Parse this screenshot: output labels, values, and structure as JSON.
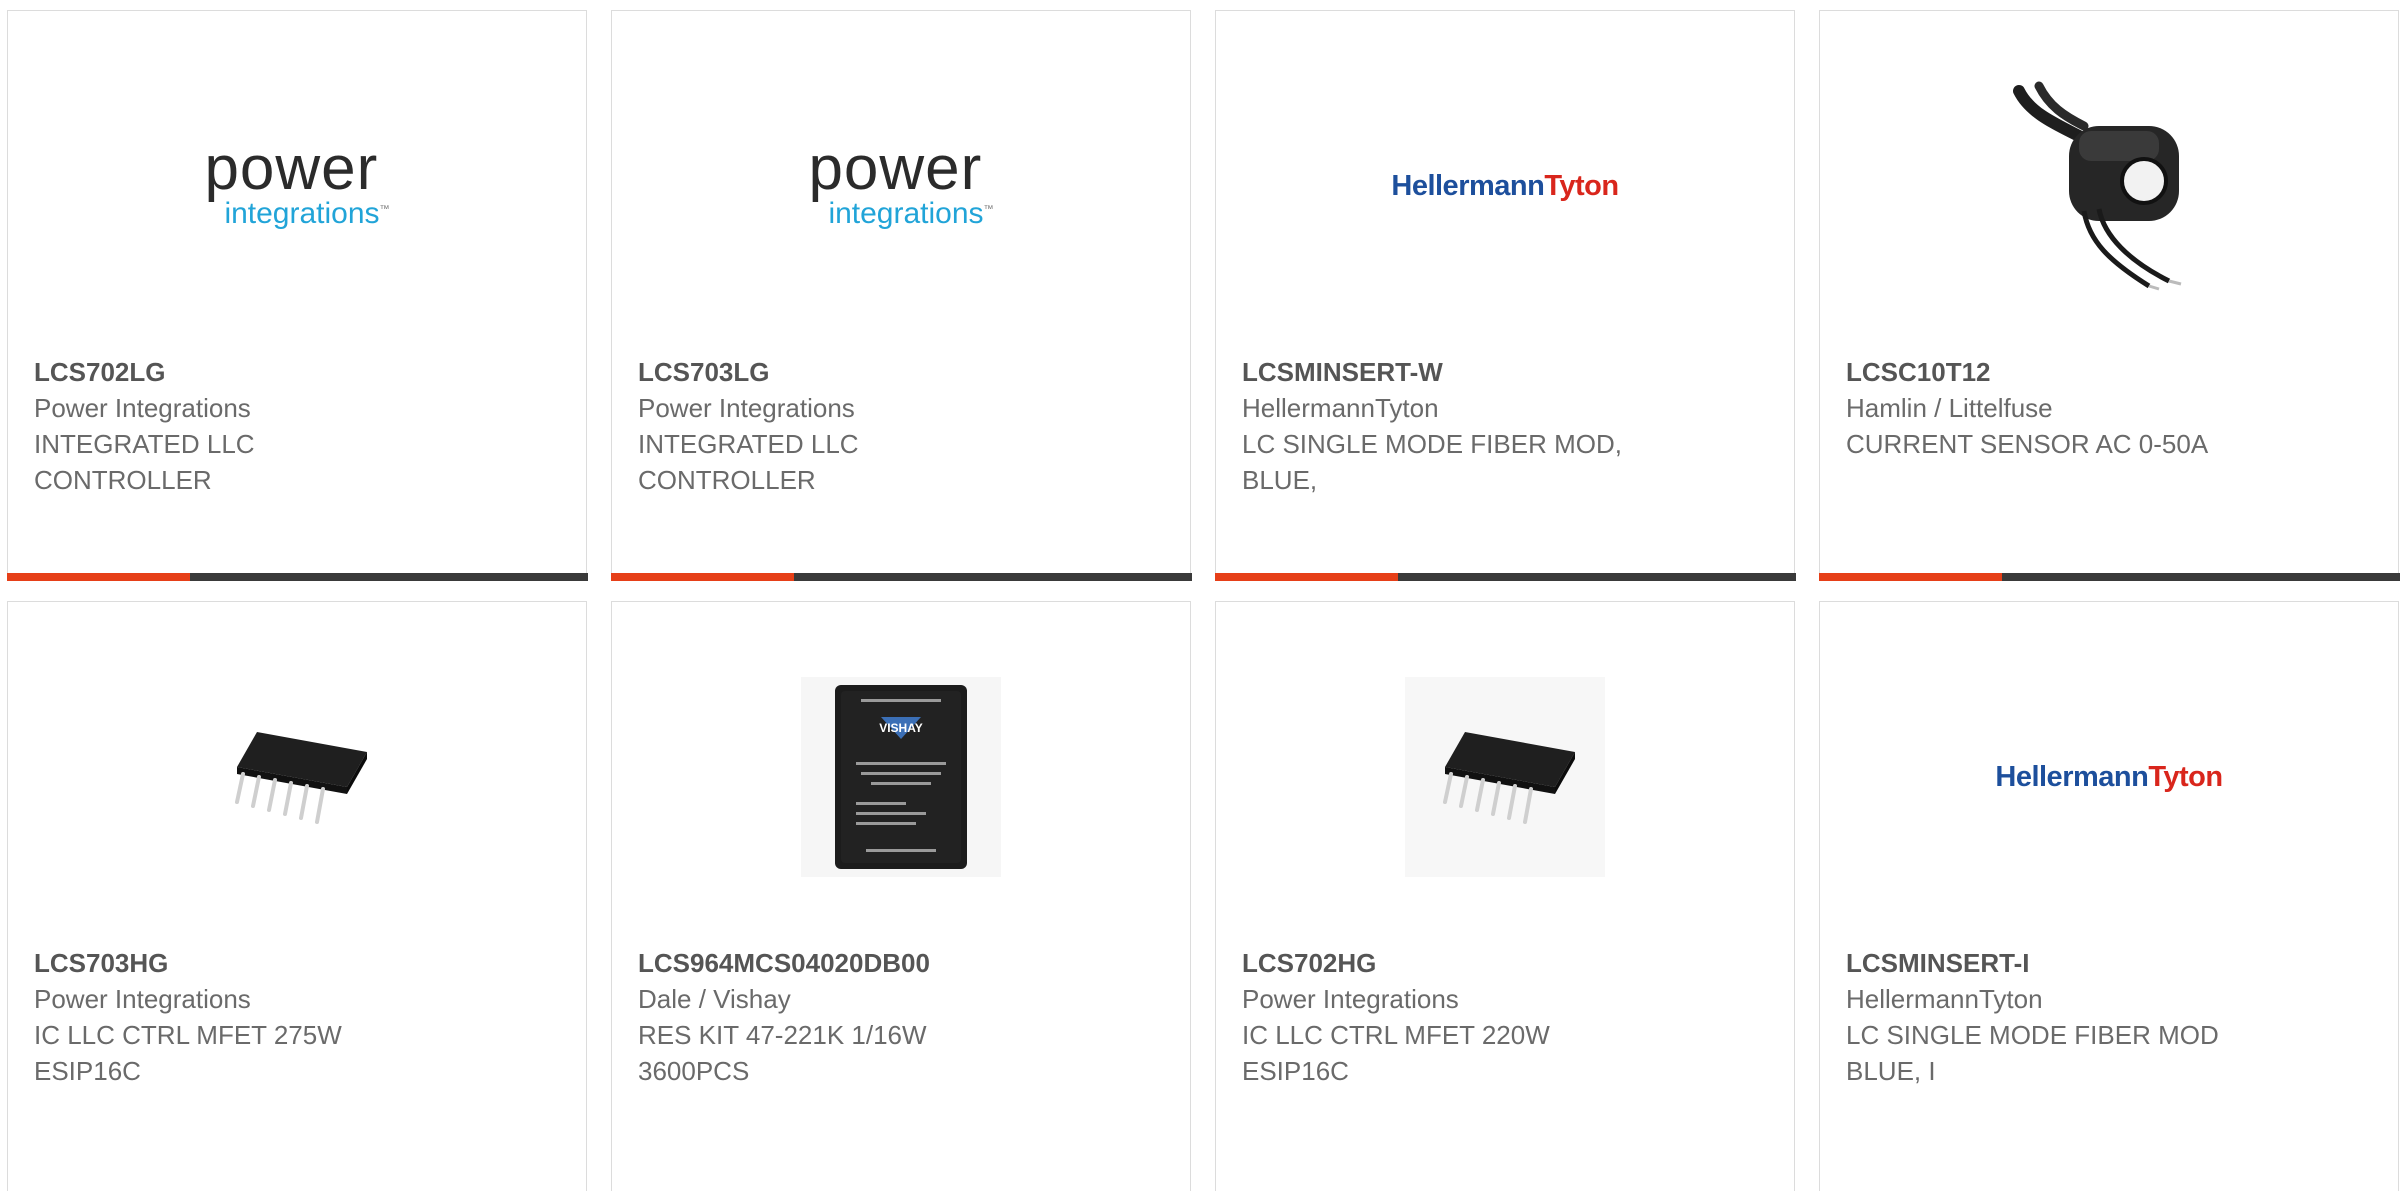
{
  "cards": [
    {
      "part_number": "LCS702LG",
      "manufacturer": "Power Integrations",
      "description": "INTEGRATED LLC\nCONTROLLER",
      "image": "power-integrations-logo",
      "logo_text": {
        "line1": "power",
        "line2": "integrations",
        "tm": "™"
      }
    },
    {
      "part_number": "LCS703LG",
      "manufacturer": "Power Integrations",
      "description": "INTEGRATED LLC\nCONTROLLER",
      "image": "power-integrations-logo",
      "logo_text": {
        "line1": "power",
        "line2": "integrations",
        "tm": "™"
      }
    },
    {
      "part_number": "LCSMINSERT-W",
      "manufacturer": "HellermannTyton",
      "description": "LC SINGLE MODE FIBER MOD,\nBLUE,",
      "image": "hellermanntyton-logo",
      "logo_text": {
        "part1": "Hellermann",
        "part2": "Tyton"
      }
    },
    {
      "part_number": "LCSC10T12",
      "manufacturer": "Hamlin / Littelfuse",
      "description": "CURRENT SENSOR AC 0-50A",
      "image": "current-sensor-photo"
    },
    {
      "part_number": "LCS703HG",
      "manufacturer": "Power Integrations",
      "description": "IC LLC CTRL MFET 275W\nESIP16C",
      "image": "ic-chip-photo"
    },
    {
      "part_number": "LCS964MCS04020DB00",
      "manufacturer": "Dale / Vishay",
      "description": "RES KIT 47-221K 1/16W\n3600PCS",
      "image": "resistor-kit-photo",
      "logo_text": {
        "brand": "VISHAY"
      }
    },
    {
      "part_number": "LCS702HG",
      "manufacturer": "Power Integrations",
      "description": "IC LLC CTRL MFET 220W\nESIP16C",
      "image": "ic-chip-photo"
    },
    {
      "part_number": "LCSMINSERT-I",
      "manufacturer": "HellermannTyton",
      "description": "LC SINGLE MODE FIBER MOD\nBLUE, I",
      "image": "hellermanntyton-logo",
      "logo_text": {
        "part1": "Hellermann",
        "part2": "Tyton"
      }
    }
  ],
  "colors": {
    "accent": "#e63f18",
    "bar": "#3a3a3a",
    "border": "#dcdcdc",
    "part_number": "#555555",
    "text": "#6a6a6a"
  }
}
